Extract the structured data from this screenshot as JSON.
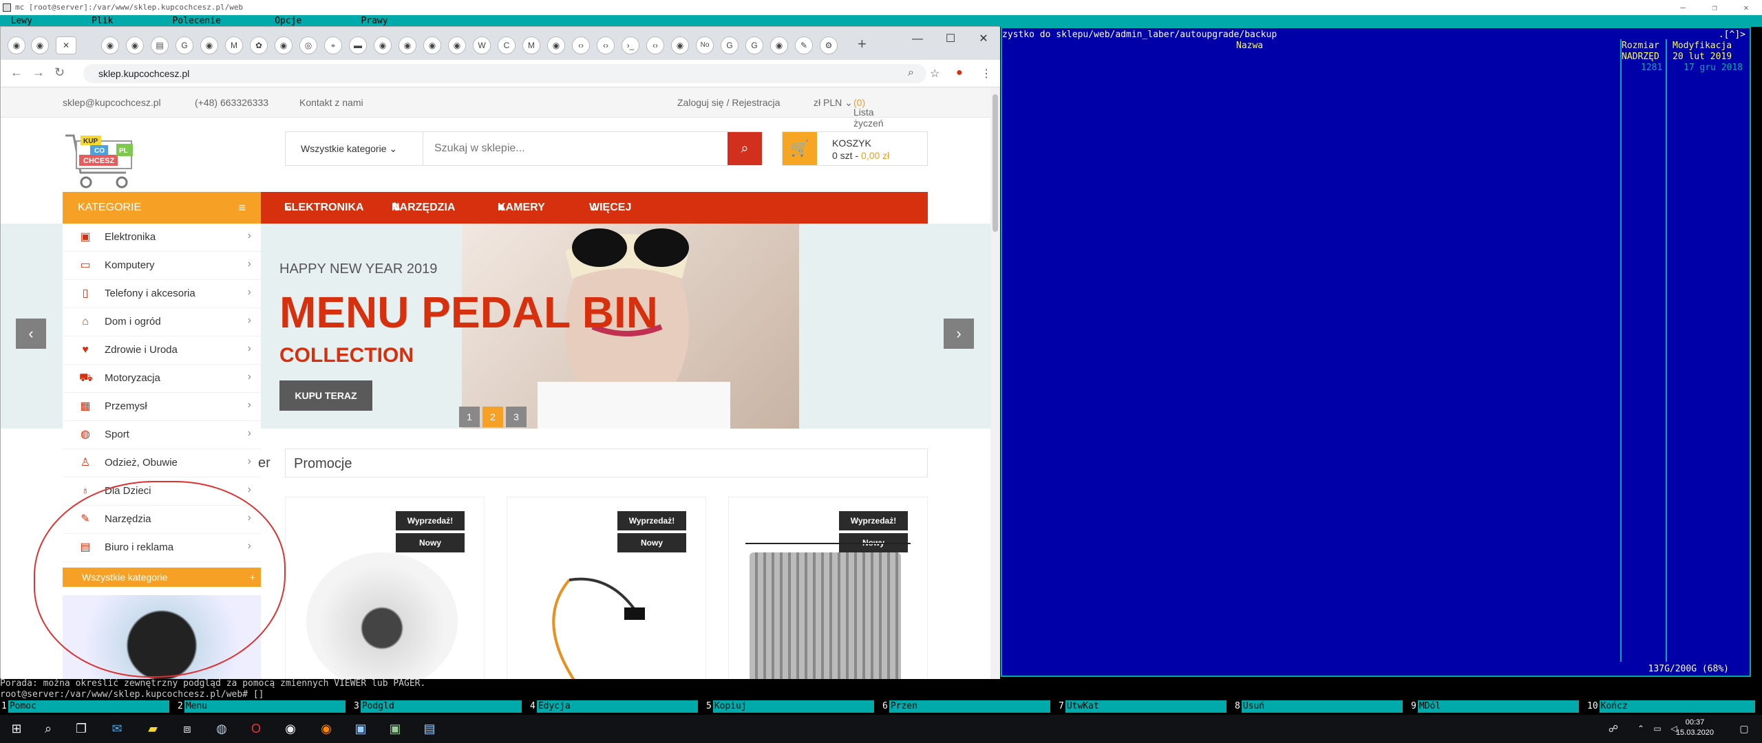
{
  "terminal": {
    "window_title": "mc [root@server]:/var/www/sklep.kupcochcesz.pl/web",
    "menu": [
      "Lewy",
      "Plik",
      "Polecenie",
      "Opcje",
      "Prawy"
    ],
    "right_panel": {
      "path": "zystko do sklepu/web/admin_laber/autoupgrade/backup",
      "corner": ".[^]>",
      "header_name": "Nazwa",
      "col_size_header": [
        "Rozmiar",
        "NADRZĘD"
      ],
      "col_mod_header": [
        "Modyfikacja",
        "20 lut 2019"
      ],
      "row1_size": "1281",
      "row1_date": "17 gru 2018",
      "disk": "137G/200G (68%)",
      "bottom_corner": "[^]"
    },
    "hint": "Porada: można określić zewnętrzny podgląd za pomocą zmiennych VIEWER lub PAGER.",
    "prompt": "root@server:/var/www/sklep.kupcochcesz.pl/web# []",
    "fkeys": [
      {
        "n": "1",
        "l": "Pomoc"
      },
      {
        "n": "2",
        "l": "Menu"
      },
      {
        "n": "3",
        "l": "Podgld"
      },
      {
        "n": "4",
        "l": "Edycja"
      },
      {
        "n": "5",
        "l": "Kopiuj"
      },
      {
        "n": "6",
        "l": "Przen"
      },
      {
        "n": "7",
        "l": "UtwKat"
      },
      {
        "n": "8",
        "l": "Usuń"
      },
      {
        "n": "9",
        "l": "MDól"
      },
      {
        "n": "10",
        "l": "Kończ"
      }
    ]
  },
  "browser": {
    "url": "sklep.kupcochcesz.pl",
    "tab_labels": [
      "No"
    ],
    "window_controls": [
      "—",
      "☐",
      "✕"
    ]
  },
  "site": {
    "topbar": {
      "email": "sklep@kupcochcesz.pl",
      "phone": "(+48) 663326333",
      "contact": "Kontakt z nami",
      "login": "Zaloguj się / Rejestracja",
      "currency": "zł PLN ⌄",
      "wishlist": "Lista życzeń",
      "wishlist_count": "(0)"
    },
    "logo": {
      "line1": "KUP",
      "line2": "CO",
      "line3": "CHCESZ",
      "line4": "PL"
    },
    "search": {
      "category": "Wszystkie kategorie",
      "placeholder": "Szukaj w sklepie..."
    },
    "cart": {
      "title": "KOSZYK",
      "items": "0 szt - ",
      "price": "0,00 zł"
    },
    "catbar": "KATEGORIE",
    "nav": [
      "ELEKTRONIKA",
      "NARZĘDZIA",
      "KAMERY",
      "WIĘCEJ"
    ],
    "banner": {
      "kicker": "HAPPY NEW YEAR 2019",
      "headline": "MENU PEDAL BIN",
      "sub": "COLLECTION",
      "button": "KUPU TERAZ",
      "dots": [
        "1",
        "2",
        "3"
      ]
    },
    "categories": [
      "Elektronika",
      "Komputery",
      "Telefony i akcesoria",
      "Dom i ogród",
      "Zdrowie i Uroda",
      "Motoryzacja",
      "Przemysł",
      "Sport",
      "Odzież, Obuwie",
      "Dla Dzieci",
      "Narzędzia",
      "Biuro i reklama"
    ],
    "all_categories": "Wszystkie kategorie",
    "promo_tab": "Promocje",
    "promo_tab_left": "er",
    "badges": {
      "sale": "Wyprzedaż!",
      "new": "Nowy"
    }
  },
  "taskbar": {
    "time": "00:37",
    "date": "15.03.2020"
  },
  "colors": {
    "accent_orange": "#f7a026",
    "accent_red": "#d7300f",
    "mc_blue": "#0000a8",
    "mc_cyan": "#00aaaa"
  }
}
